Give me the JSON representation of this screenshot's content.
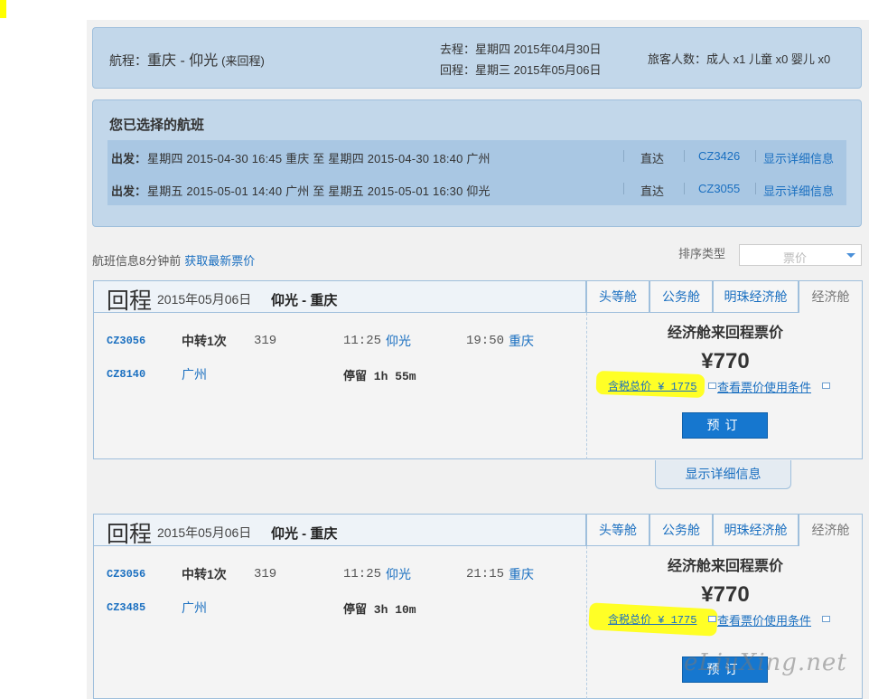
{
  "summary": {
    "route_label": "航程：",
    "route_cities": "重庆 - 仰光",
    "route_type": "(来回程)",
    "outbound": "去程：星期四 2015年04月30日",
    "return": "回程：星期三 2015年05月06日",
    "passengers": "旅客人数：成人 x1 儿童 x0 婴儿 x0"
  },
  "selected": {
    "title": "您已选择的航班",
    "rows": [
      {
        "label": "出发：",
        "detail": "星期四  2015-04-30 16:45  重庆  至  星期四  2015-04-30 18:40  广州",
        "type": "直达",
        "flight": "CZ3426",
        "link": "显示详细信息"
      },
      {
        "label": "出发：",
        "detail": "星期五  2015-05-01 14:40  广州  至  星期五  2015-05-01 16:30  仰光",
        "type": "直达",
        "flight": "CZ3055",
        "link": "显示详细信息"
      }
    ]
  },
  "info": {
    "updated": "航班信息8分钟前",
    "refresh": "获取最新票价"
  },
  "sort": {
    "label": "排序类型",
    "value": "票价"
  },
  "cards": [
    {
      "big": "回程",
      "date": "2015年05月06日",
      "route": "仰光 - 重庆",
      "tabs": [
        "头等舱",
        "公务舱",
        "明珠经济舱",
        "经济舱"
      ],
      "code1": "CZ3056",
      "transfer": "中转1次",
      "num": "319",
      "dep_time": "11:25",
      "dep_city": "仰光",
      "arr_time": "19:50",
      "arr_city": "重庆",
      "code2": "CZ8140",
      "via": "广州",
      "stop": "停留 1h 55m",
      "price_title": "经济舱来回程票价",
      "price": "¥770",
      "tax": "含税总价 ¥ 1775",
      "cond": "查看票价使用条件",
      "book": "预订",
      "detail": "显示详细信息"
    },
    {
      "big": "回程",
      "date": "2015年05月06日",
      "route": "仰光 - 重庆",
      "tabs": [
        "头等舱",
        "公务舱",
        "明珠经济舱",
        "经济舱"
      ],
      "code1": "CZ3056",
      "transfer": "中转1次",
      "num": "319",
      "dep_time": "11:25",
      "dep_city": "仰光",
      "arr_time": "21:15",
      "arr_city": "重庆",
      "code2": "CZ3485",
      "via": "广州",
      "stop": "停留 3h 10m",
      "price_title": "经济舱来回程票价",
      "price": "¥770",
      "tax": "含税总价 ¥ 1775",
      "cond": "查看票价使用条件",
      "book": "预订"
    }
  ],
  "watermark": "eLiuXing.net",
  "colors": {
    "link": "#1a6fc0",
    "panel": "#c2d7ea",
    "highlight": "#ffff1a",
    "button": "#1677cf"
  }
}
